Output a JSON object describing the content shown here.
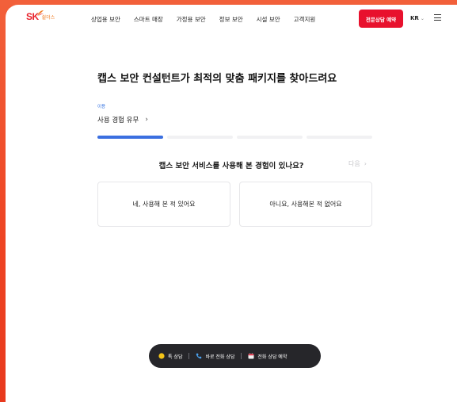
{
  "brand": {
    "logo_text": "SK",
    "logo_sub": "쉴더스"
  },
  "nav": {
    "items": [
      {
        "label": "상업용 보안"
      },
      {
        "label": "스마트 매장"
      },
      {
        "label": "가정용 보안"
      },
      {
        "label": "정보 보안"
      },
      {
        "label": "시설 보안"
      },
      {
        "label": "고객지원"
      }
    ],
    "cta_label": "전문상담 예약",
    "lang": "KR",
    "lang_chevron": "⌄"
  },
  "main": {
    "title": "캡스 보안 컨설턴트가 최적의 맞춤 패키지를 찾아드려요",
    "step_tag": "이용",
    "step_label": "사용 경험 유무",
    "step_chevron": "›",
    "progress": {
      "total_steps": 4,
      "current_step": 1
    },
    "question": "캡스 보안 서비스를 사용해 본 경험이 있나요?",
    "next_label": "다음",
    "next_chevron": "›",
    "options": [
      {
        "label": "네, 사용해 본 적 있어요"
      },
      {
        "label": "아니요, 사용해본 적 없어요"
      }
    ]
  },
  "floating_bar": {
    "items": [
      {
        "label": "톡 상담",
        "icon": "chat-bubble-icon"
      },
      {
        "label": "바로 전화 상담",
        "icon": "phone-icon"
      },
      {
        "label": "전화 상담 예약",
        "icon": "calendar-icon"
      }
    ]
  },
  "colors": {
    "accent_red": "#e8112d",
    "progress_blue": "#3b6fe0",
    "background_orange": "#ee4423",
    "floating_bar": "#26262a"
  }
}
